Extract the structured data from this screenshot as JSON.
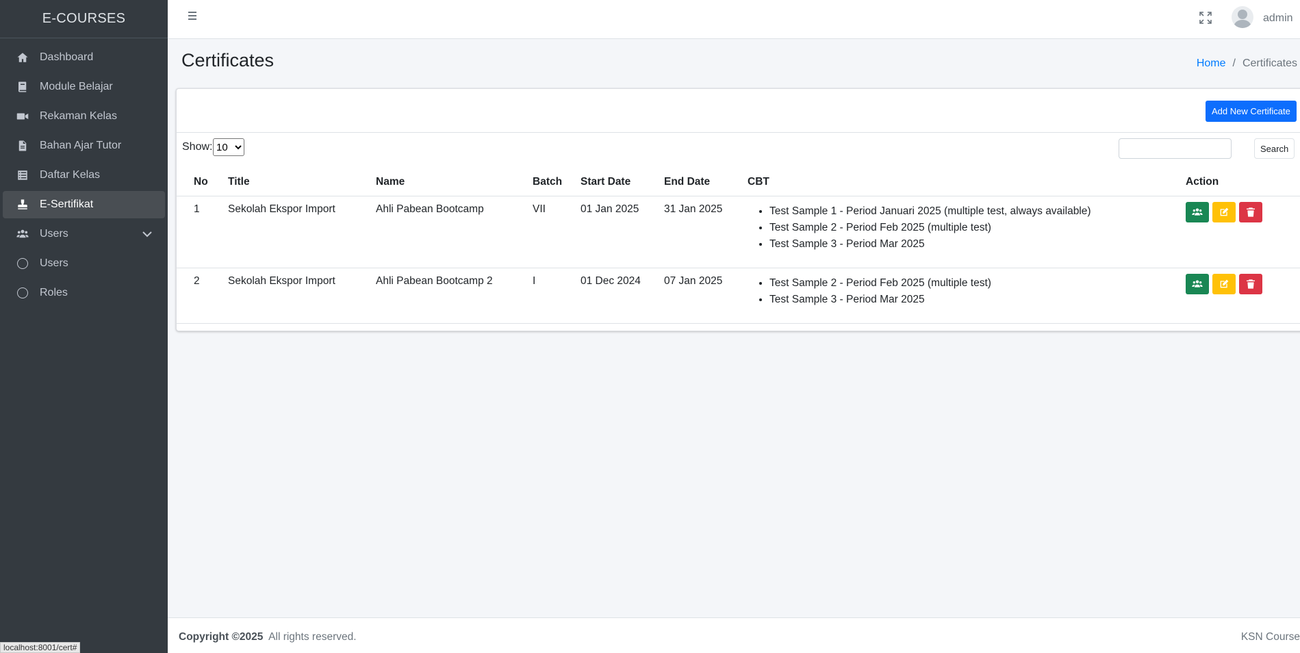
{
  "app": {
    "brand": "E-COURSES"
  },
  "sidebar": {
    "items": [
      {
        "label": "Dashboard",
        "icon": "home-icon"
      },
      {
        "label": "Module Belajar",
        "icon": "book-icon"
      },
      {
        "label": "Rekaman Kelas",
        "icon": "video-icon"
      },
      {
        "label": "Bahan Ajar Tutor",
        "icon": "file-icon"
      },
      {
        "label": "Daftar Kelas",
        "icon": "list-icon"
      },
      {
        "label": "E-Sertifikat",
        "icon": "stamp-icon",
        "active": true
      },
      {
        "label": "Users",
        "icon": "users-icon"
      },
      {
        "label": "Users",
        "icon": "circle-icon"
      },
      {
        "label": "Roles",
        "icon": "circle-icon"
      }
    ]
  },
  "topbar": {
    "username": "admin"
  },
  "page": {
    "title": "Certificates",
    "breadcrumb": {
      "home": "Home",
      "separator": "/",
      "current": "Certificates"
    }
  },
  "card": {
    "add_button": "Add New Certificate",
    "show_label": "Show:",
    "page_size": "10",
    "search_button": "Search"
  },
  "table": {
    "headers": [
      "No",
      "Title",
      "Name",
      "Batch",
      "Start Date",
      "End Date",
      "CBT",
      "Action"
    ],
    "rows": [
      {
        "no": "1",
        "title": "Sekolah Ekspor Import",
        "name": "Ahli Pabean Bootcamp",
        "batch": "VII",
        "start": "01 Jan 2025",
        "end": "31 Jan 2025",
        "cbt": [
          "Test Sample 1 - Period Januari 2025 (multiple test, always available)",
          "Test Sample 2 - Period Feb 2025 (multiple test)",
          "Test Sample 3 - Period Mar 2025"
        ]
      },
      {
        "no": "2",
        "title": "Sekolah Ekspor Import",
        "name": "Ahli Pabean Bootcamp 2",
        "batch": "I",
        "start": "01 Dec 2024",
        "end": "07 Jan 2025",
        "cbt": [
          "Test Sample 2 - Period Feb 2025 (multiple test)",
          "Test Sample 3 - Period Mar 2025"
        ]
      }
    ]
  },
  "footer": {
    "copyright_bold": "Copyright ©2025",
    "copyright_rest": "All rights reserved.",
    "right": "KSN Course"
  },
  "status_url": "localhost:8001/cert#",
  "colors": {
    "sidebar_bg": "#343a40",
    "primary": "#0d6efd",
    "success": "#198754",
    "warning": "#ffc107",
    "danger": "#dc3545"
  }
}
